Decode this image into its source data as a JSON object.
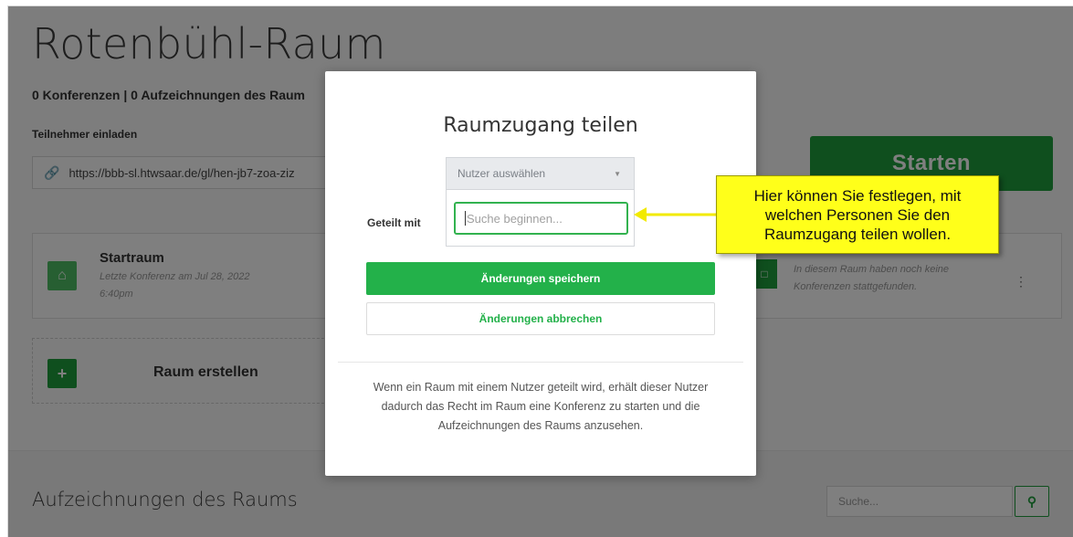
{
  "room": {
    "title": "Rotenbühl-Raum",
    "stats": "0 Konferenzen | 0 Aufzeichnungen des Raum",
    "invite_label": "Teilnehmer einladen",
    "invite_url": "https://bbb-sl.htwsaar.de/gl/hen-jb7-zoa-ziz",
    "start_label": "Starten"
  },
  "rooms": [
    {
      "name": "Startraum",
      "meta": "Letzte Konferenz am Jul 28, 2022 6:40pm",
      "icon": "home-icon"
    },
    {
      "name": "",
      "meta": "In diesem Raum haben noch keine Konferenzen stattgefunden.",
      "icon": "door-icon"
    }
  ],
  "create_room_label": "Raum erstellen",
  "recordings": {
    "title": "Aufzeichnungen des Raums",
    "search_placeholder": "Suche..."
  },
  "modal": {
    "title": "Raumzugang teilen",
    "user_select_placeholder": "Nutzer auswählen",
    "shared_with_label": "Geteilt mit",
    "search_placeholder": "Suche beginnen...",
    "save_label": "Änderungen speichern",
    "cancel_label": "Änderungen abbrechen",
    "info": "Wenn ein Raum mit einem Nutzer geteilt wird, erhält dieser Nutzer dadurch das Recht im Raum eine Konferenz zu starten und die Aufzeichnungen des Raums anzusehen."
  },
  "callout": {
    "text": "Hier können Sie festlegen, mit welchen Personen Sie den Raumzugang teilen wollen."
  },
  "colors": {
    "accent": "#23b14a",
    "callout": "#ffff1a",
    "overlay": "rgba(0,0,0,0.5)"
  }
}
